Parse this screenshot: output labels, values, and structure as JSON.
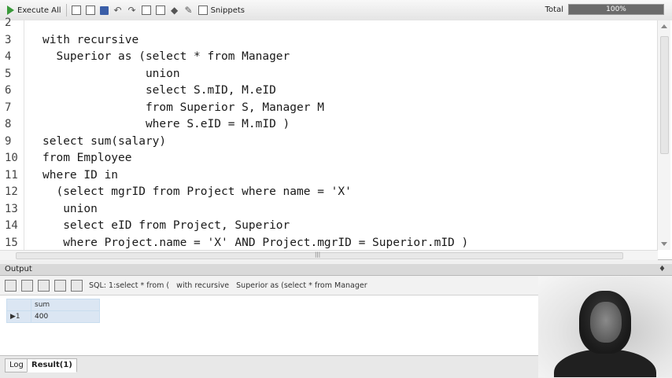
{
  "toolbar": {
    "execute_all": "Execute All",
    "snippets": "Snippets",
    "total_label": "Total",
    "progress_text": "100%",
    "progress_value": 1.0
  },
  "editor": {
    "lines": [
      {
        "num": "2",
        "text": ""
      },
      {
        "num": "3",
        "text": "with recursive"
      },
      {
        "num": "4",
        "text": "  Superior as (select * from Manager"
      },
      {
        "num": "5",
        "text": "               union"
      },
      {
        "num": "6",
        "text": "               select S.mID, M.eID"
      },
      {
        "num": "7",
        "text": "               from Superior S, Manager M"
      },
      {
        "num": "8",
        "text": "               where S.eID = M.mID )"
      },
      {
        "num": "9",
        "text": "select sum(salary)"
      },
      {
        "num": "10",
        "text": "from Employee"
      },
      {
        "num": "11",
        "text": "where ID in"
      },
      {
        "num": "12",
        "text": "  (select mgrID from Project where name = 'X'"
      },
      {
        "num": "13",
        "text": "   union"
      },
      {
        "num": "14",
        "text": "   select eID from Project, Superior"
      },
      {
        "num": "15",
        "text": "   where Project.name = 'X' AND Project.mgrID = Superior.mID )"
      }
    ]
  },
  "output": {
    "title": "Output",
    "sql_label": "SQL: 1:select * from (   with recursive   Superior as (select * from Manager",
    "grid": {
      "column_header": "sum",
      "row_header": "▶1",
      "value": "400"
    },
    "tabs": [
      {
        "label": "Log"
      },
      {
        "label": "Result(1)"
      }
    ]
  }
}
